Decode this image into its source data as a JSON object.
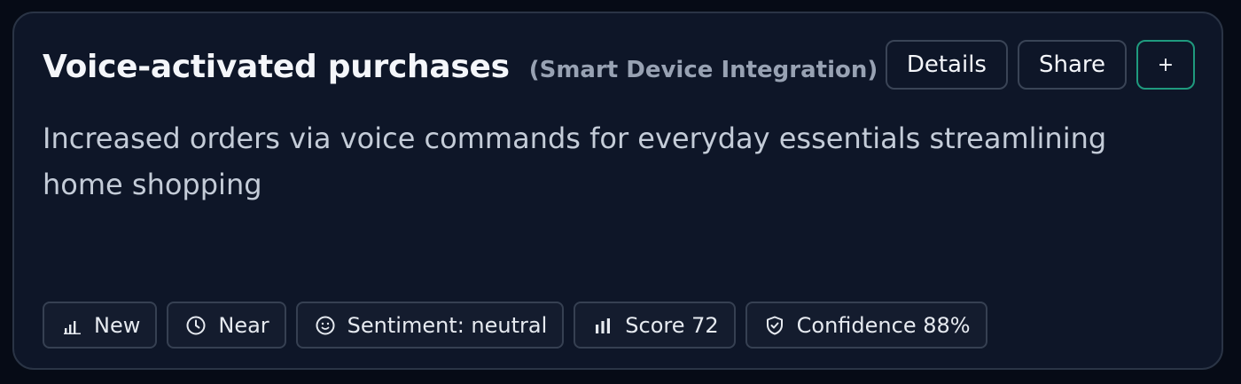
{
  "card": {
    "title": "Voice-activated purchases",
    "category": "(Smart Device Integration)",
    "description": "Increased orders via voice commands for everyday essentials streamlining home shopping"
  },
  "actions": {
    "details_label": "Details",
    "share_label": "Share",
    "add_label": "+"
  },
  "chips": [
    {
      "icon": "bar-chart-low-icon",
      "label": "New"
    },
    {
      "icon": "clock-icon",
      "label": "Near"
    },
    {
      "icon": "smile-face-icon",
      "label": "Sentiment: neutral"
    },
    {
      "icon": "bar-chart-icon",
      "label": "Score 72"
    },
    {
      "icon": "shield-check-icon",
      "label": "Confidence 88%"
    }
  ],
  "colors": {
    "background": "#060b16",
    "card": "#0e1628",
    "accent_border": "#1f9a7e"
  }
}
